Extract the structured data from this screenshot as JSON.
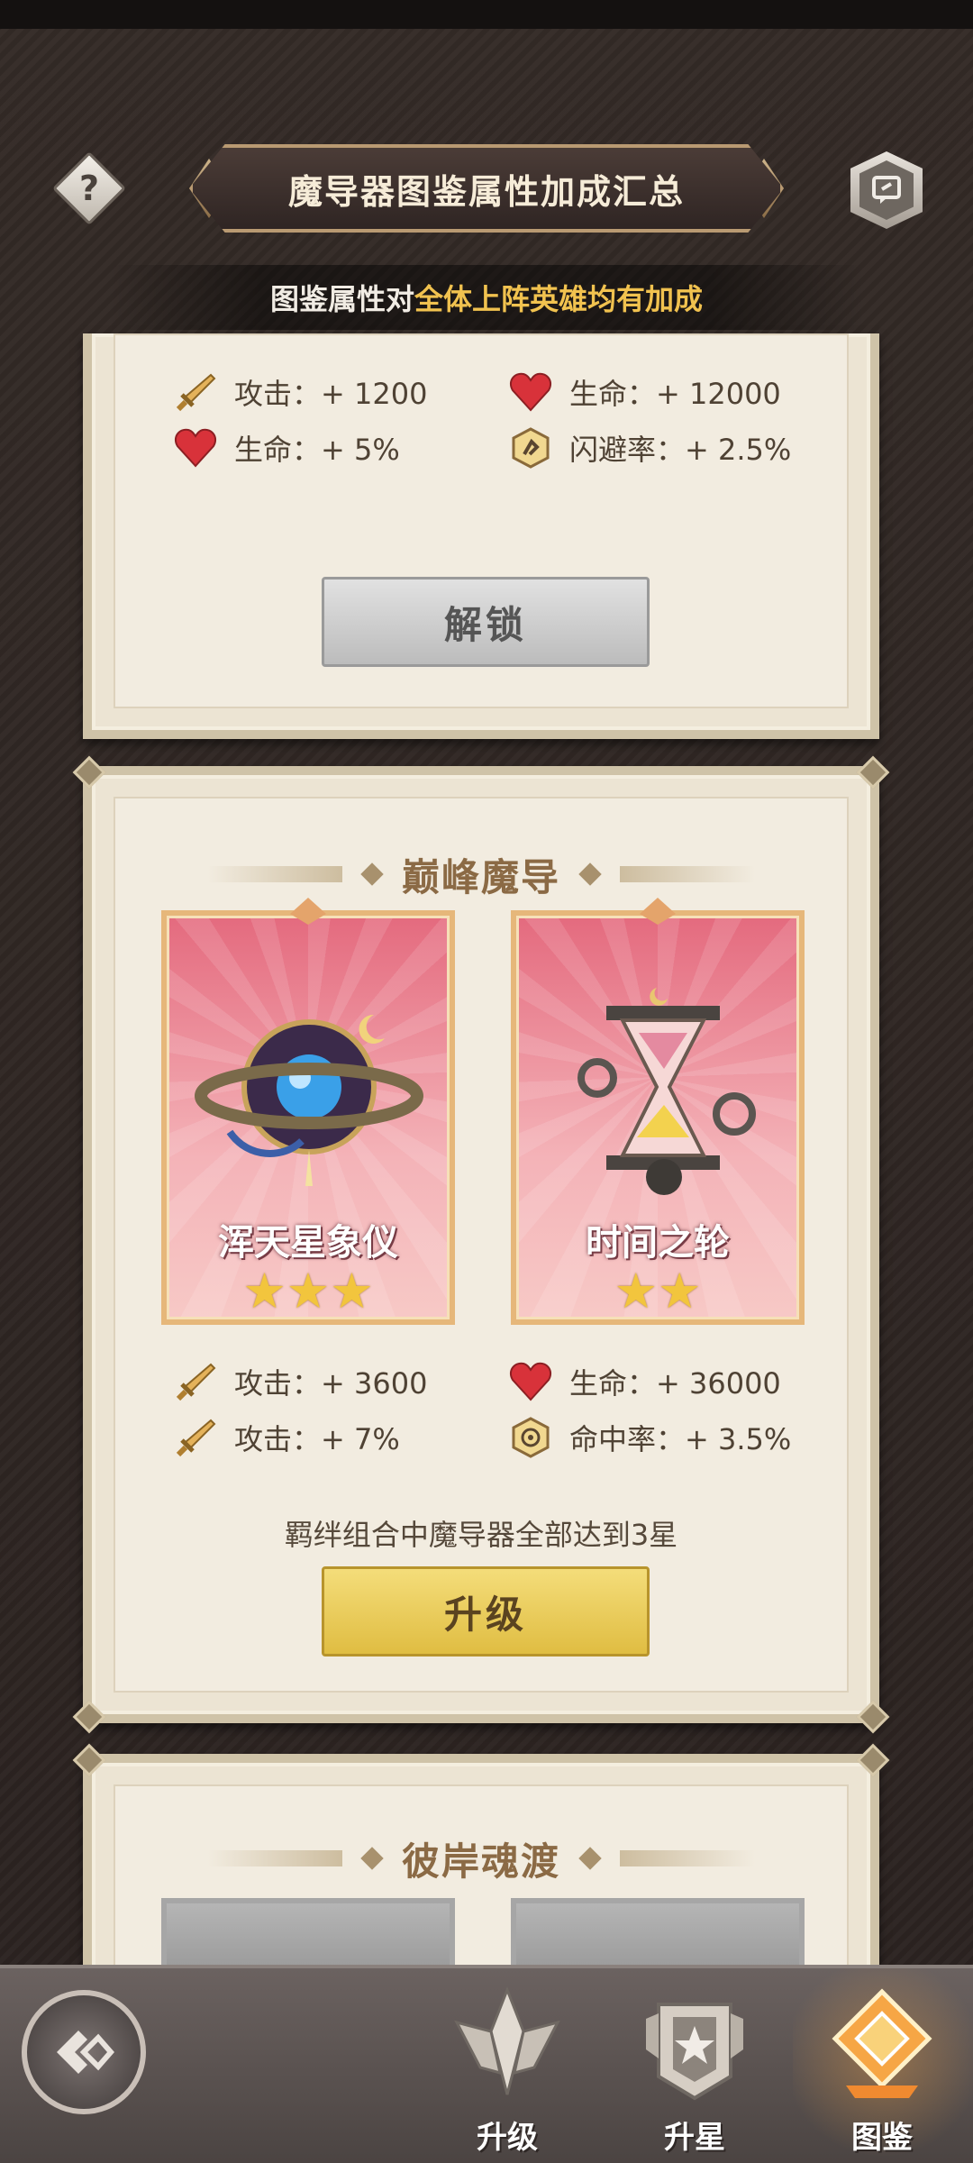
{
  "header": {
    "help_icon": "question-mark-icon",
    "help_label": "?",
    "title": "魔导器图鉴属性加成汇总",
    "share_icon": "share-icon"
  },
  "subtitle": {
    "prefix": "图鉴属性对",
    "highlight": "全体上阵英雄均有加成",
    "highlight_color": "#f1c24f"
  },
  "panel1": {
    "stats": [
      {
        "icon": "sword-icon",
        "text": "攻击：+ 1200"
      },
      {
        "icon": "heart-icon",
        "text": "生命：+ 12000"
      },
      {
        "icon": "heart-icon",
        "text": "生命：+ 5%"
      },
      {
        "icon": "dodge-icon",
        "text": "闪避率：+ 2.5%"
      }
    ],
    "button": "解锁"
  },
  "panel2": {
    "title": "巅峰魔导",
    "cards": [
      {
        "name": "浑天星象仪",
        "stars": "★★★",
        "star_count": 3
      },
      {
        "name": "时间之轮",
        "stars": "★★",
        "star_count": 2
      }
    ],
    "stats": [
      {
        "icon": "sword-icon",
        "text": "攻击：+ 3600"
      },
      {
        "icon": "heart-icon",
        "text": "生命：+ 36000"
      },
      {
        "icon": "sword-icon",
        "text": "攻击：+ 7%"
      },
      {
        "icon": "target-icon",
        "text": "命中率：+ 3.5%"
      }
    ],
    "hint": "羁绊组合中魔导器全部达到3星",
    "button": "升级"
  },
  "panel3": {
    "title": "彼岸魂渡"
  },
  "bottom_nav": {
    "back_icon": "back-arrow-icon",
    "items": [
      {
        "label": "升级",
        "icon": "upgrade-emblem-icon"
      },
      {
        "label": "升星",
        "icon": "star-up-emblem-icon"
      },
      {
        "label": "图鉴",
        "icon": "codex-emblem-icon",
        "selected": true
      }
    ]
  },
  "colors": {
    "accent_gold": "#f1c24f",
    "card_pink": "#e46a7e",
    "heart_red": "#d8323a"
  }
}
